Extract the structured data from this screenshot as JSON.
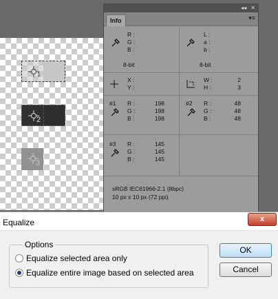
{
  "canvas": {
    "samplers": [
      "1",
      "2",
      "3"
    ]
  },
  "info_panel": {
    "tab": "Info",
    "top_controls": [
      "◂◂",
      "✕"
    ],
    "menu_icon": "≡",
    "section1": {
      "left": {
        "labels": [
          "R :",
          "G :",
          "B :"
        ],
        "mode": "8-bit"
      },
      "right": {
        "labels": [
          "L :",
          "a :",
          "b :"
        ],
        "mode": "8-bit"
      }
    },
    "section2": {
      "left": {
        "labels": [
          "X :",
          "Y :"
        ]
      },
      "right": {
        "labels": [
          "W :",
          "H :"
        ],
        "values": [
          "2",
          "3"
        ]
      }
    },
    "sampler1": {
      "id": "#1",
      "labels": [
        "R :",
        "G :",
        "B :"
      ],
      "values": [
        "198",
        "198",
        "198"
      ]
    },
    "sampler2": {
      "id": "#2",
      "labels": [
        "R :",
        "G :",
        "B :"
      ],
      "values": [
        "48",
        "48",
        "48"
      ]
    },
    "sampler3": {
      "id": "#3",
      "labels": [
        "R :",
        "G :",
        "B :"
      ],
      "values": [
        "145",
        "145",
        "145"
      ]
    },
    "footer": {
      "profile": "sRGB IEC61966-2.1 (8bpc)",
      "doc_size": "10 px x 10 px (72 ppi)"
    }
  },
  "dialog": {
    "title": "Equalize",
    "close_label": "x",
    "group_label": "Options",
    "option1": "Equalize selected area only",
    "option2": "Equalize entire image based on selected area",
    "selected_option": 2,
    "ok_label": "OK",
    "cancel_label": "Cancel"
  }
}
